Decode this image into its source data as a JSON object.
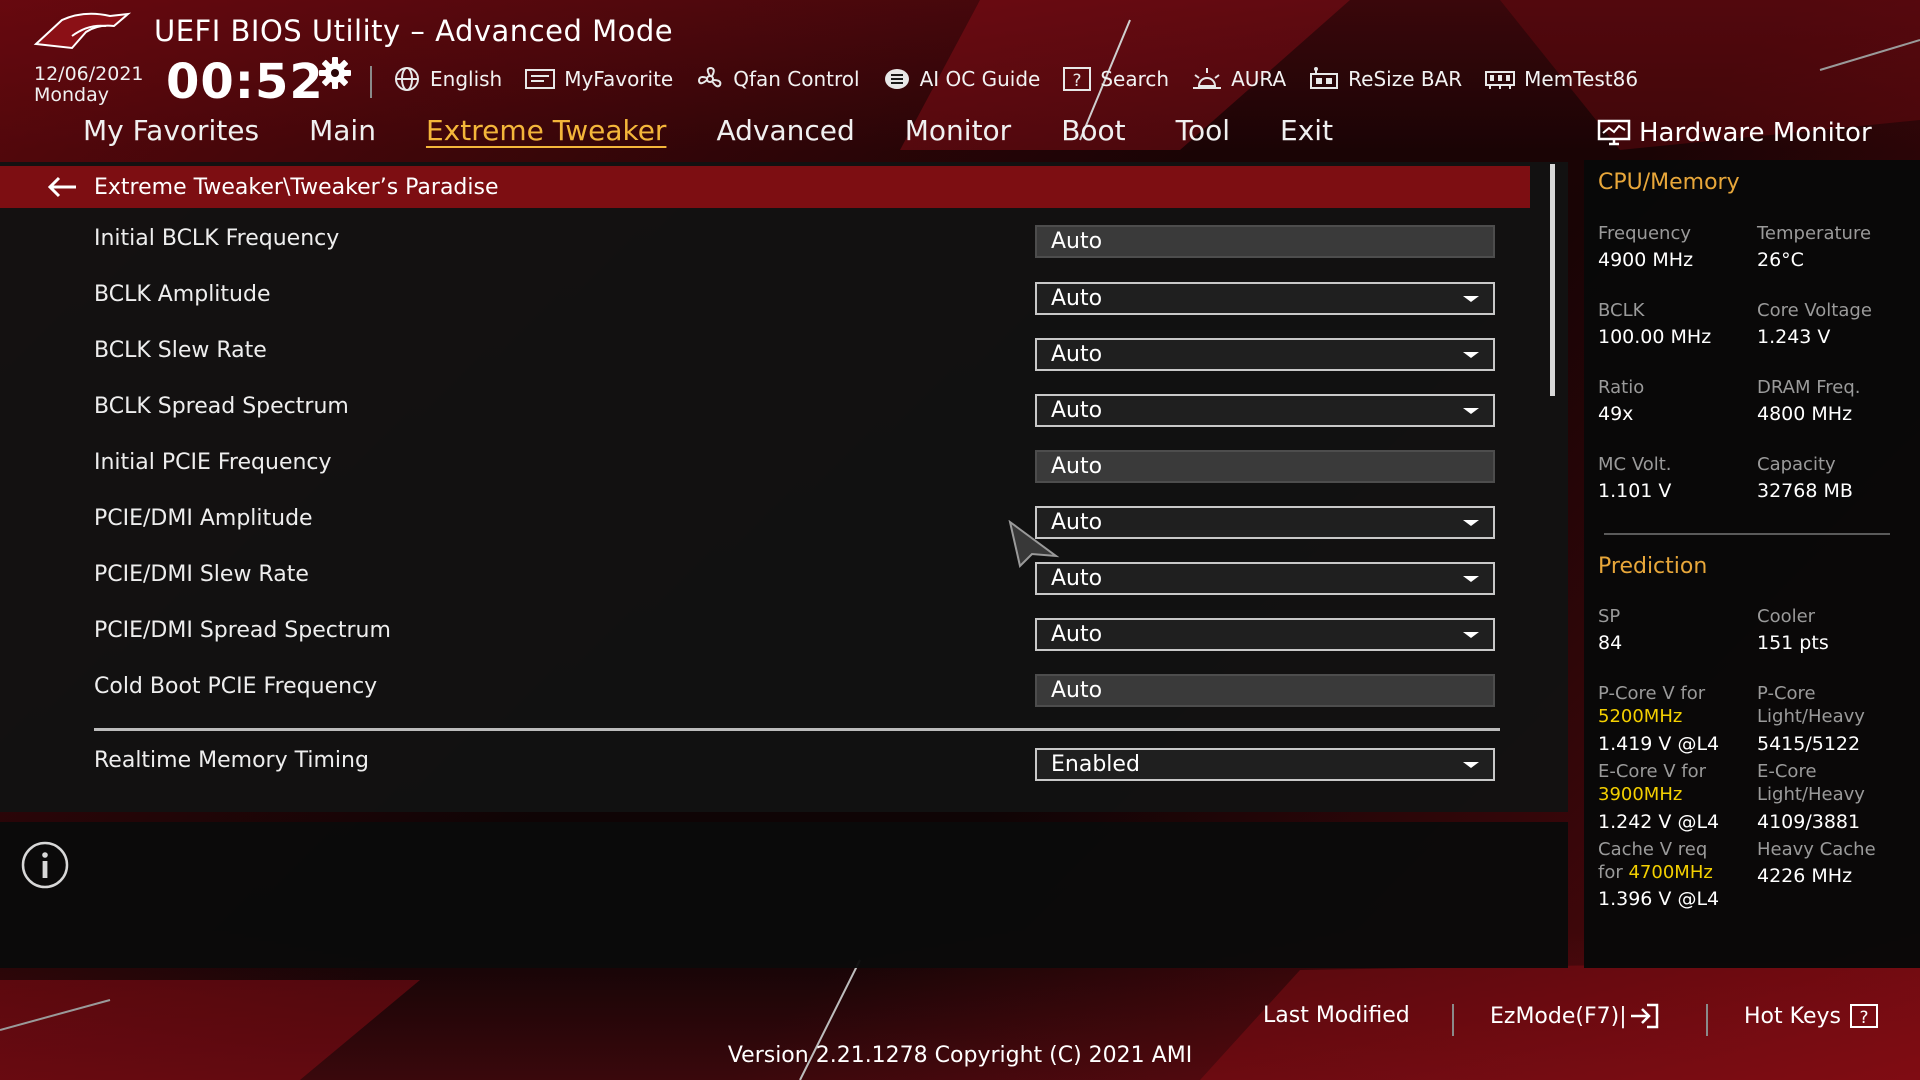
{
  "app": {
    "title": "UEFI BIOS Utility – Advanced Mode"
  },
  "header": {
    "date": "12/06/2021",
    "weekday": "Monday",
    "time": "00:52",
    "toolbar": [
      {
        "label": "English",
        "icon": "globe-icon"
      },
      {
        "label": "MyFavorite",
        "icon": "favorite-icon"
      },
      {
        "label": "Qfan Control",
        "icon": "fan-icon"
      },
      {
        "label": "AI OC Guide",
        "icon": "ai-chip-icon"
      },
      {
        "label": "Search",
        "icon": "search-question-icon"
      },
      {
        "label": "AURA",
        "icon": "aura-light-icon"
      },
      {
        "label": "ReSize BAR",
        "icon": "resize-bar-icon"
      },
      {
        "label": "MemTest86",
        "icon": "memory-icon"
      }
    ]
  },
  "menu": {
    "items": [
      "My Favorites",
      "Main",
      "Extreme Tweaker",
      "Advanced",
      "Monitor",
      "Boot",
      "Tool",
      "Exit"
    ],
    "active": "Extreme Tweaker"
  },
  "breadcrumb": {
    "path": "Extreme Tweaker\\Tweaker’s Paradise"
  },
  "settings": [
    {
      "label": "Initial BCLK Frequency",
      "value": "Auto",
      "type": "static"
    },
    {
      "label": "BCLK Amplitude",
      "value": "Auto",
      "type": "dropdown"
    },
    {
      "label": "BCLK Slew Rate",
      "value": "Auto",
      "type": "dropdown"
    },
    {
      "label": "BCLK Spread Spectrum",
      "value": "Auto",
      "type": "dropdown"
    },
    {
      "label": "Initial PCIE Frequency",
      "value": "Auto",
      "type": "static"
    },
    {
      "label": "PCIE/DMI Amplitude",
      "value": "Auto",
      "type": "dropdown"
    },
    {
      "label": "PCIE/DMI Slew Rate",
      "value": "Auto",
      "type": "dropdown"
    },
    {
      "label": "PCIE/DMI Spread Spectrum",
      "value": "Auto",
      "type": "dropdown"
    },
    {
      "label": "Cold Boot PCIE Frequency",
      "value": "Auto",
      "type": "static"
    },
    {
      "label": "Realtime Memory Timing",
      "value": "Enabled",
      "type": "dropdown"
    }
  ],
  "hardware_monitor": {
    "title": "Hardware Monitor",
    "cpu_memory": {
      "heading": "CPU/Memory",
      "frequency_label": "Frequency",
      "frequency_value": "4900 MHz",
      "temperature_label": "Temperature",
      "temperature_value": "26°C",
      "bclk_label": "BCLK",
      "bclk_value": "100.00 MHz",
      "core_voltage_label": "Core Voltage",
      "core_voltage_value": "1.243 V",
      "ratio_label": "Ratio",
      "ratio_value": "49x",
      "dram_freq_label": "DRAM Freq.",
      "dram_freq_value": "4800 MHz",
      "mc_volt_label": "MC Volt.",
      "mc_volt_value": "1.101 V",
      "capacity_label": "Capacity",
      "capacity_value": "32768 MB"
    },
    "prediction": {
      "heading": "Prediction",
      "sp_label": "SP",
      "sp_value": "84",
      "cooler_label": "Cooler",
      "cooler_value": "151 pts",
      "pcore_v_label": "P-Core V for",
      "pcore_v_freq": "5200MHz",
      "pcore_v_value": "1.419 V @L4",
      "pcore_lh_label_1": "P-Core",
      "pcore_lh_label_2": "Light/Heavy",
      "pcore_lh_value": "5415/5122",
      "ecore_v_label": "E-Core V for",
      "ecore_v_freq": "3900MHz",
      "ecore_v_value": "1.242 V @L4",
      "ecore_lh_label_1": "E-Core",
      "ecore_lh_label_2": "Light/Heavy",
      "ecore_lh_value": "4109/3881",
      "cache_v_label_1": "Cache V req",
      "cache_v_label_2": "for",
      "cache_v_freq": "4700MHz",
      "cache_v_value": "1.396 V @L4",
      "heavy_cache_label": "Heavy Cache",
      "heavy_cache_value": "4226 MHz"
    }
  },
  "footer": {
    "last_modified": "Last Modified",
    "ezmode": "EzMode(F7)|",
    "hot_keys": "Hot Keys",
    "version": "Version 2.21.1278 Copyright (C) 2021 AMI"
  },
  "colors": {
    "accent_active": "#f4b63a",
    "section_heading": "#e8a73a",
    "highlight_freq": "#f4d000",
    "breadcrumb_bg": "#7d0e12"
  }
}
